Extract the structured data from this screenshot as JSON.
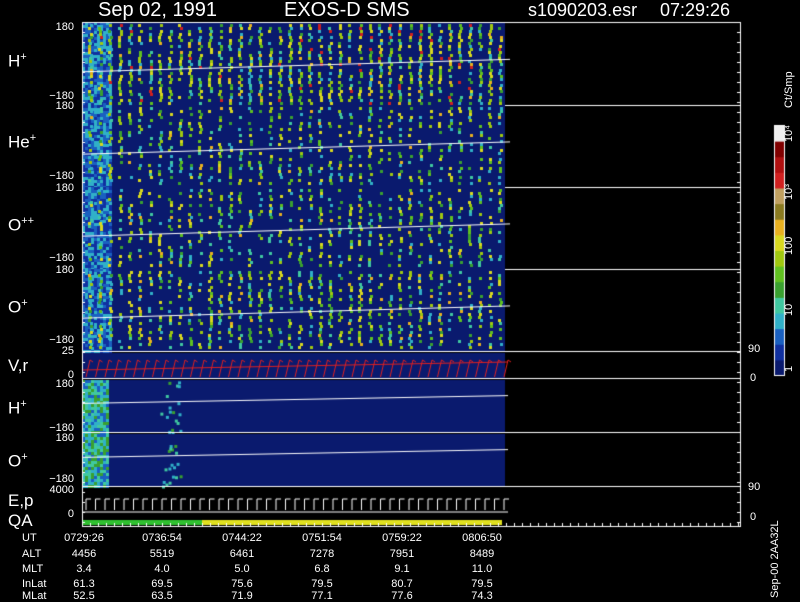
{
  "header": {
    "date": "Sep 02, 1991",
    "instrument": "EXOS-D SMS",
    "file": "s1090203.esr",
    "time": "07:29:26"
  },
  "colorbar": {
    "unit": "Ct/Smp",
    "ticks": [
      "1",
      "10",
      "100",
      "10³",
      "10⁴"
    ],
    "colors": [
      "#0a1a6e",
      "#1030a0",
      "#1a60c0",
      "#30b0c8",
      "#40c8a0",
      "#3aa030",
      "#60c020",
      "#a0c810",
      "#d8d820",
      "#e8b020",
      "#8a7a20",
      "#c0a060",
      "#d02020",
      "#b01010",
      "#800000",
      "#f0f0f0"
    ]
  },
  "panels": {
    "h_plus": {
      "label_base": "H",
      "label_sup": "+",
      "ymax": "180",
      "ymin": "−180"
    },
    "he_plus": {
      "label_base": "He",
      "label_sup": "+",
      "ymax": "180",
      "ymin": "−180"
    },
    "o_plusplus": {
      "label_base": "O",
      "label_sup": "++",
      "ymax": "180",
      "ymin": "−180"
    },
    "o_plus": {
      "label_base": "O",
      "label_sup": "+",
      "ymax": "180",
      "ymin": "−180"
    },
    "vr": {
      "label": "V,r",
      "ymax": "25",
      "ymin": "0",
      "rmax": "90",
      "rmin": "0"
    },
    "h_plus_2": {
      "label_base": "H",
      "label_sup": "+",
      "ymax": "180",
      "ymin": "−180"
    },
    "o_plus_2": {
      "label_base": "O",
      "label_sup": "+",
      "ymax": "180",
      "ymin": "−180"
    },
    "ep": {
      "label": "E,p",
      "ymax": "4000",
      "ymin": "0",
      "rmax": "90",
      "rmin": "0"
    },
    "qa": {
      "label": "QA"
    }
  },
  "ut_table": {
    "rows": [
      {
        "label": "UT",
        "values": [
          "0729:26",
          "0736:54",
          "0744:22",
          "0751:54",
          "0759:22",
          "0806:50"
        ]
      },
      {
        "label": "ALT",
        "values": [
          "4456",
          "5519",
          "6461",
          "7278",
          "7951",
          "8489"
        ]
      },
      {
        "label": "MLT",
        "values": [
          "3.4",
          "4.0",
          "5.0",
          "6.8",
          "9.1",
          "11.0"
        ]
      },
      {
        "label": "InLat",
        "values": [
          "61.3",
          "69.5",
          "75.6",
          "79.5",
          "80.7",
          "79.5"
        ]
      },
      {
        "label": "MLat",
        "values": [
          "52.5",
          "63.5",
          "71.9",
          "77.1",
          "77.6",
          "74.3"
        ]
      }
    ]
  },
  "footer_id": "Sep-00 2AA32L",
  "chart_data": {
    "type": "heatmap",
    "title": "Sep 02, 1991 EXOS-D SMS",
    "x_ticks": [
      "0729:26",
      "0736:54",
      "0744:22",
      "0751:54",
      "0759:22",
      "0806:50"
    ],
    "series": [
      {
        "name": "H+",
        "ylim": [
          -180,
          180
        ]
      },
      {
        "name": "He+",
        "ylim": [
          -180,
          180
        ]
      },
      {
        "name": "O++",
        "ylim": [
          -180,
          180
        ]
      },
      {
        "name": "O+",
        "ylim": [
          -180,
          180
        ]
      },
      {
        "name": "V,r",
        "ylim": [
          0,
          25
        ],
        "right_ylim": [
          0,
          90
        ]
      },
      {
        "name": "H+",
        "ylim": [
          -180,
          180
        ]
      },
      {
        "name": "O+",
        "ylim": [
          -180,
          180
        ]
      },
      {
        "name": "E,p",
        "ylim": [
          0,
          4000
        ],
        "right_ylim": [
          0,
          90
        ]
      }
    ],
    "color_scale": {
      "unit": "Ct/Smp",
      "log": true,
      "range": [
        1,
        10000
      ]
    }
  }
}
